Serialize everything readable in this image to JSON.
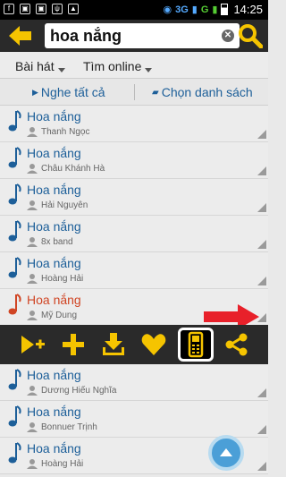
{
  "status": {
    "network": "3G",
    "network2": "G",
    "time": "14:25"
  },
  "search": {
    "query": "hoa nắng"
  },
  "filters": {
    "category": "Bài hát",
    "online": "Tìm online"
  },
  "actions": {
    "play_all": "Nghe tất cả",
    "choose_list": "Chọn danh sách"
  },
  "songs": [
    {
      "title": "Hoa nắng",
      "artist": "Thanh Ngọc"
    },
    {
      "title": "Hoa nắng",
      "artist": "Châu  Khánh Hà"
    },
    {
      "title": "Hoa nắng",
      "artist": "Hải Nguyên"
    },
    {
      "title": "Hoa nắng",
      "artist": "8x band"
    },
    {
      "title": "Hoa nắng",
      "artist": "Hoàng Hải"
    },
    {
      "title": "Hoa nắng",
      "artist": "Mỹ Dung"
    },
    {
      "title": "Hoa nắng",
      "artist": "Dương Hiếu Nghĩa"
    },
    {
      "title": "Hoa nắng",
      "artist": "Bonnuer Trịnh"
    },
    {
      "title": "Hoa nắng",
      "artist": "Hoàng Hải"
    }
  ],
  "colors": {
    "accent": "#f5c400",
    "title_blue": "#1d5f99",
    "title_active": "#d04524",
    "toolbar_bg": "#2a2a2a"
  }
}
